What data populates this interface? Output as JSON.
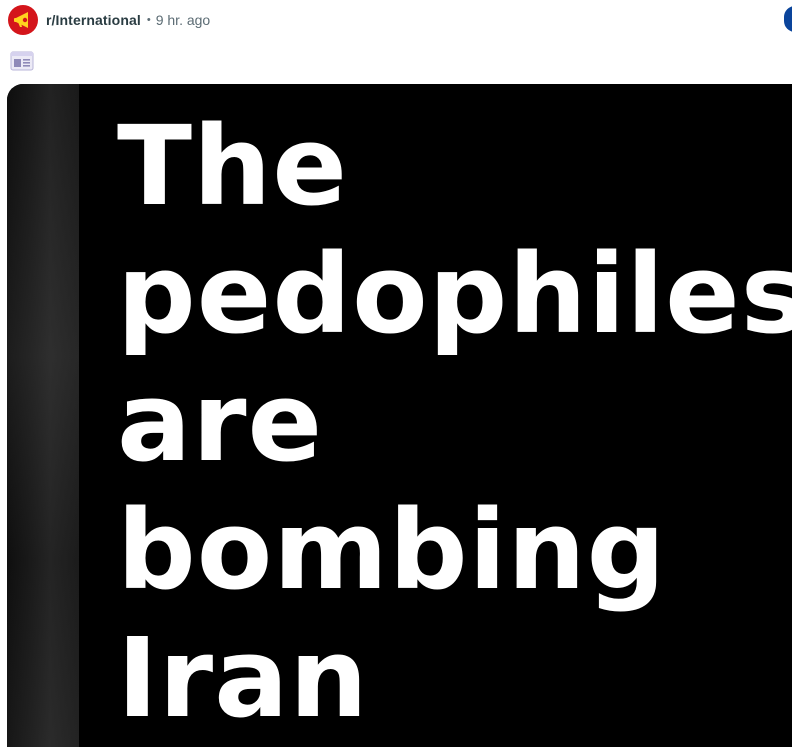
{
  "post": {
    "subreddit": "r/International",
    "separator": "•",
    "timestamp": "9 hr. ago",
    "avatar_icon": "megaphone-icon",
    "thumbnail_icon": "link-preview-icon"
  },
  "media": {
    "image_text_lines": [
      "The",
      "pedophiles",
      "are",
      "bombing",
      "Iran"
    ]
  },
  "colors": {
    "avatar_bg": "#d4151b",
    "join_button": "#0a449b",
    "subreddit_text": "#2a3c42",
    "meta_text": "#5c6c74"
  }
}
